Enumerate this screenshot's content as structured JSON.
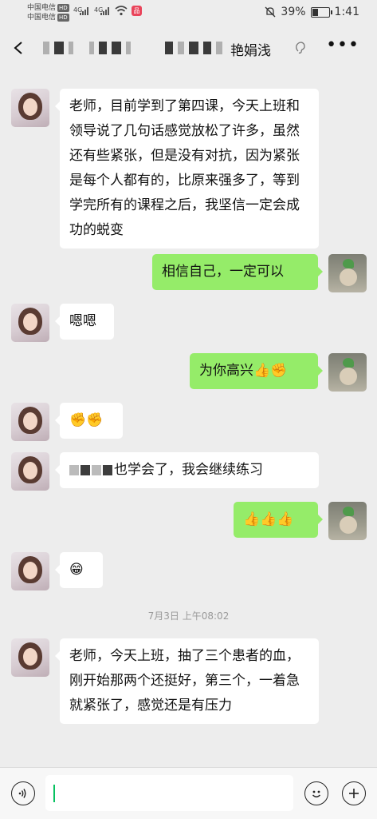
{
  "status_bar": {
    "carrier1": "中国电信",
    "carrier2": "中国电信",
    "hd": "HD",
    "network1": "4G",
    "network2": "4G",
    "battery_percent": "39%",
    "battery_level": 0.39,
    "time": "1:41"
  },
  "header": {
    "title": "艳娟浅"
  },
  "messages": [
    {
      "side": "left",
      "text": "老师，目前学到了第四课，今天上班和领导说了几句话感觉放松了许多，虽然还有些紧张，但是没有对抗，因为紧张是每个人都有的，比原来强多了，等到学完所有的课程之后，我坚信一定会成功的蜕变"
    },
    {
      "side": "right",
      "text": "相信自己，一定可以"
    },
    {
      "side": "left",
      "text": "嗯嗯"
    },
    {
      "side": "right",
      "text": "为你高兴👍✊"
    },
    {
      "side": "left",
      "text": "✊✊"
    },
    {
      "side": "left",
      "text": "也学会了，我会继续练习"
    },
    {
      "side": "right",
      "text": "👍👍👍"
    },
    {
      "side": "left",
      "text": "😁"
    },
    {
      "side": "left",
      "text": "老师，今天上班，抽了三个患者的血，刚开始那两个还挺好，第三个，一着急就紧张了，感觉还是有压力"
    }
  ],
  "timestamp": "7月3日 上午08:02",
  "icons": {
    "voice": "voice-icon",
    "emoji": "emoji-icon",
    "plus": "plus-icon",
    "back": "back-arrow-icon",
    "more": "more-icon",
    "ear": "earpiece-icon"
  }
}
